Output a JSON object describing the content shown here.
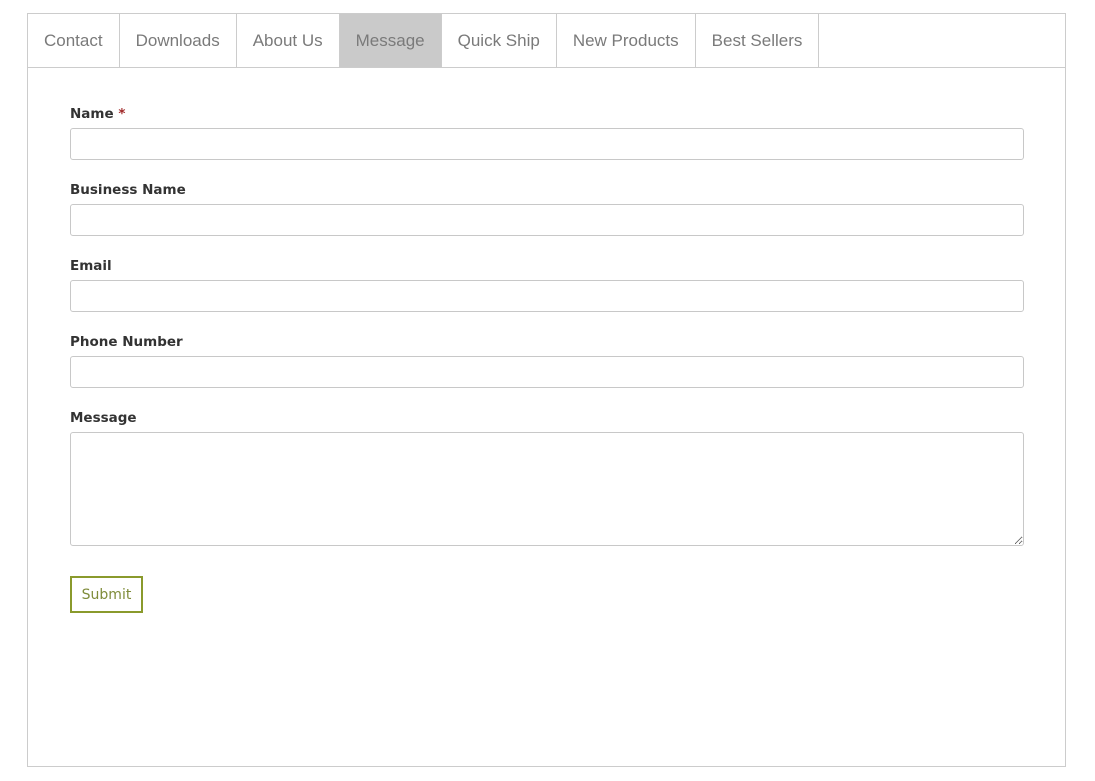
{
  "tabs": [
    {
      "label": "Contact",
      "active": false
    },
    {
      "label": "Downloads",
      "active": false
    },
    {
      "label": "About Us",
      "active": false
    },
    {
      "label": "Message",
      "active": true
    },
    {
      "label": "Quick Ship",
      "active": false
    },
    {
      "label": "New Products",
      "active": false
    },
    {
      "label": "Best Sellers",
      "active": false
    }
  ],
  "form": {
    "name": {
      "label": "Name",
      "required_mark": "*",
      "value": ""
    },
    "business_name": {
      "label": "Business Name",
      "value": ""
    },
    "email": {
      "label": "Email",
      "value": ""
    },
    "phone": {
      "label": "Phone Number",
      "value": ""
    },
    "message": {
      "label": "Message",
      "value": ""
    },
    "submit_label": "Submit"
  },
  "colors": {
    "active_tab_bg": "#cacaca",
    "submit_accent": "#8a9a2c",
    "required": "#a02828"
  }
}
